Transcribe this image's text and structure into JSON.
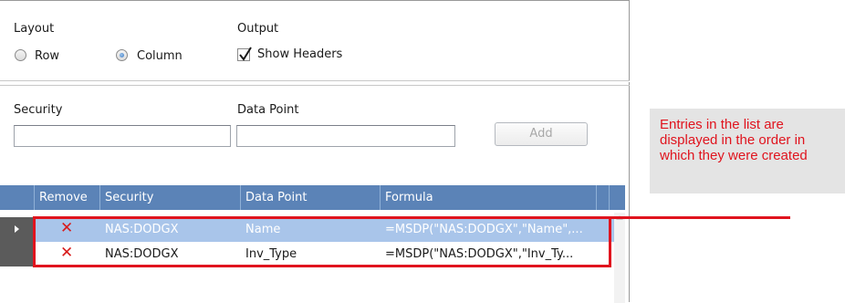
{
  "layout": {
    "label": "Layout",
    "options": [
      {
        "label": "Row",
        "selected": false
      },
      {
        "label": "Column",
        "selected": true
      }
    ]
  },
  "output": {
    "label": "Output",
    "show_headers_label": "Show Headers",
    "show_headers_checked": true
  },
  "security_field": {
    "label": "Security",
    "value": ""
  },
  "datapoint_field": {
    "label": "Data Point",
    "value": ""
  },
  "add_button": {
    "label": "Add",
    "enabled": false
  },
  "grid": {
    "columns": [
      "Remove",
      "Security",
      "Data Point",
      "Formula"
    ],
    "rows": [
      {
        "remove_icon": "red-x-icon",
        "security": "NAS:DODGX",
        "data_point": "Name",
        "formula": "=MSDP(\"NAS:DODGX\",\"Name\",...",
        "selected": true
      },
      {
        "remove_icon": "red-x-icon",
        "security": "NAS:DODGX",
        "data_point": "Inv_Type",
        "formula": "=MSDP(\"NAS:DODGX\",\"Inv_Ty...",
        "selected": false
      }
    ]
  },
  "callout": {
    "lines": [
      "Entries in the list are",
      "displayed in the order in",
      "which they were created"
    ],
    "color": "#e0141e"
  },
  "colors": {
    "grid_header": "#5b83b7",
    "selected_row": "#a9c5ea",
    "highlight": "#e0141e"
  }
}
